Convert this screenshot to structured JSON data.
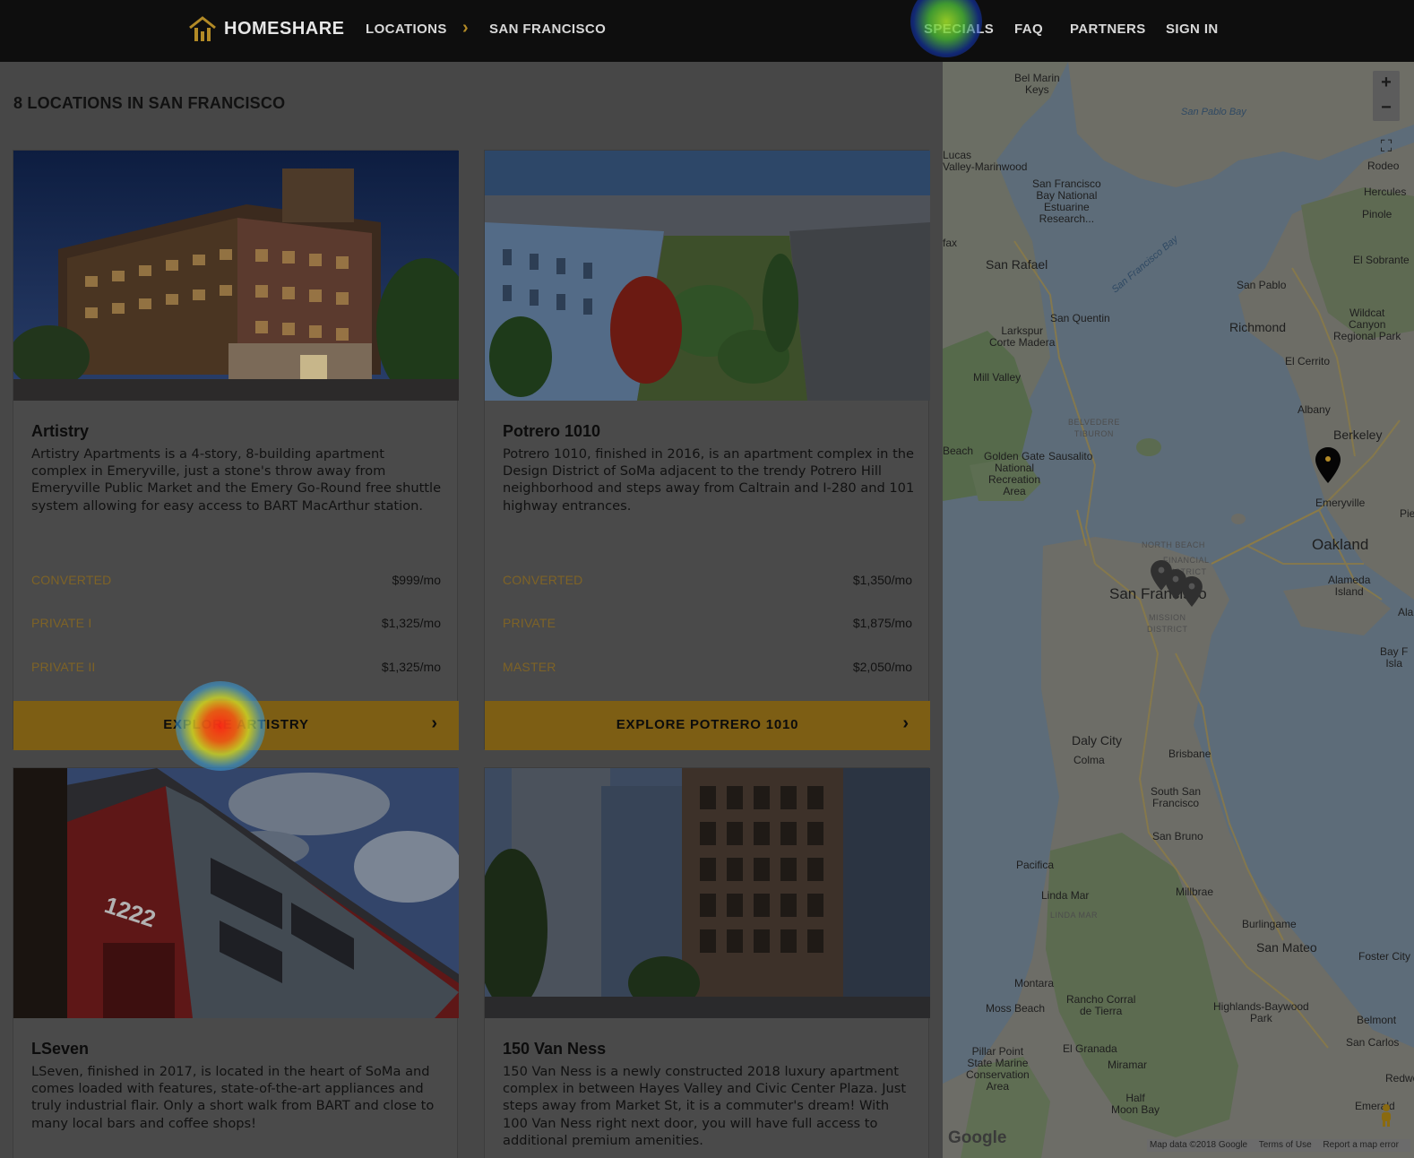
{
  "header": {
    "brand": "HOMESHARE",
    "breadcrumb": [
      "LOCATIONS",
      "SAN FRANCISCO"
    ],
    "nav": [
      "SPECIALS",
      "FAQ",
      "PARTNERS",
      "SIGN IN"
    ]
  },
  "list": {
    "heading": "8 LOCATIONS IN SAN FRANCISCO",
    "cards": [
      {
        "title": "Artistry",
        "description": "Artistry Apartments is a 4-story, 8-building apartment complex in Emeryville, just a stone's throw away from Emeryville Public Market and the Emery Go-Round free shuttle system allowing for easy access to BART MacArthur station.",
        "prices": [
          {
            "type": "CONVERTED",
            "value": "$999/mo"
          },
          {
            "type": "PRIVATE I",
            "value": "$1,325/mo"
          },
          {
            "type": "PRIVATE II",
            "value": "$1,325/mo"
          }
        ],
        "button": "EXPLORE ARTISTRY"
      },
      {
        "title": "Potrero 1010",
        "description": "Potrero 1010, finished in 2016, is an apartment complex in the Design District of SoMa adjacent to the trendy Potrero Hill neighborhood and steps away from Caltrain and I-280 and 101 highway entrances.",
        "prices": [
          {
            "type": "CONVERTED",
            "value": "$1,350/mo"
          },
          {
            "type": "PRIVATE",
            "value": "$1,875/mo"
          },
          {
            "type": "MASTER",
            "value": "$2,050/mo"
          }
        ],
        "button": "EXPLORE POTRERO 1010"
      },
      {
        "title": "LSeven",
        "description": "LSeven, finished in 2017, is located in the heart of SoMa and comes loaded with features, state-of-the-art appliances and truly industrial flair. Only a short walk from BART and close to many local bars and coffee shops!"
      },
      {
        "title": "150 Van Ness",
        "description": "150 Van Ness is a newly constructed 2018 luxury apartment complex in between Hayes Valley and Civic Center Plaza. Just steps away from Market St, it is a commuter's dream! With 100 Van Ness right next door, you will have full access to additional premium amenities."
      }
    ]
  },
  "map": {
    "labels": {
      "sf": "San Francisco",
      "oakland": "Oakland",
      "berkeley": "Berkeley",
      "richmond": "Richmond",
      "san_rafael": "San Rafael",
      "san_mateo": "San Mateo",
      "daly_city": "Daly City",
      "south_sf": "South San\nFrancisco",
      "bel_marin": "Bel Marin\nKeys",
      "lucas_valley": "Lucas\nValley-Marinwood",
      "sf_bay_reserve": "San Francisco\nBay National\nEstuarine\nResearch...",
      "san_pablo_bay": "San Pablo Bay",
      "sf_bay": "San Francisco Bay",
      "rodeo": "Rodeo",
      "hercules": "Hercules",
      "pinole": "Pinole",
      "el_sobrante": "El Sobrante",
      "san_pablo": "San Pablo",
      "wildcat": "Wildcat\nCanyon\nRegional Park",
      "el_cerrito": "El Cerrito",
      "albany": "Albany",
      "emeryville": "Emeryville",
      "alameda_island": "Alameda\nIsland",
      "alameda": "Alame",
      "bay_farm": "Bay F\nIsla",
      "fairfax": "fax",
      "larkspur": "Larkspur\nCorte Madera",
      "san_quentin": "San Quentin",
      "mill_valley": "Mill Valley",
      "sausalito": "Sausalito",
      "ggnra": "Golden Gate\nNational\nRecreation\nArea",
      "belvedere": "BELVEDERE\nTIBURON",
      "north_beach": "NORTH BEACH",
      "financial": "FINANCIAL\nDISTRICT",
      "mission": "MISSION\nDISTRICT",
      "brisbane": "Brisbane",
      "colma": "Colma",
      "san_bruno": "San Bruno",
      "pacifica": "Pacifica",
      "linda_mar": "Linda Mar",
      "linda_mar_caps": "LINDA MAR",
      "millbrae": "Millbrae",
      "burlingame": "Burlingame",
      "foster_city": "Foster City",
      "montara": "Montara",
      "moss_beach": "Moss Beach",
      "rancho": "Rancho Corral\nde Tierra",
      "highlands": "Highlands-Baywood\nPark",
      "belmont": "Belmont",
      "san_carlos": "San Carlos",
      "redwood": "Redwo",
      "pillar_point": "Pillar Point\nState Marine\nConservation\nArea",
      "el_granada": "El Granada",
      "miramar": "Miramar",
      "half_moon": "Half\nMoon Bay",
      "emerald": "Emerald",
      "beach": "Beach",
      "pie": "Pie"
    },
    "zoom_in": "+",
    "zoom_out": "−",
    "google": "Google",
    "footer": [
      "Map data ©2018 Google",
      "Terms of Use",
      "Report a map error"
    ]
  },
  "colors": {
    "accent": "#b28a26",
    "button": "#7d5e14",
    "topbar": "#0e0e0e"
  }
}
